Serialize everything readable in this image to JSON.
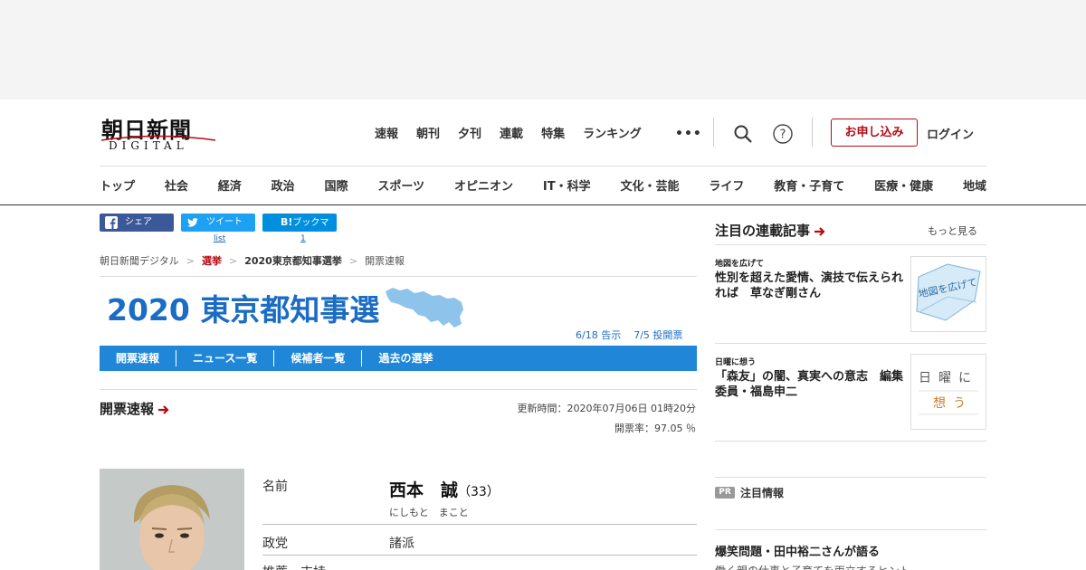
{
  "header": {
    "logo_main": "朝日新聞",
    "logo_sub": "DIGITAL",
    "top_nav": [
      "速報",
      "朝刊",
      "夕刊",
      "連載",
      "特集",
      "ランキング"
    ],
    "more_dots": "•••",
    "apply_label": "お申し込み",
    "login_label": "ログイン"
  },
  "categories": [
    "トップ",
    "社会",
    "経済",
    "政治",
    "国際",
    "スポーツ",
    "オピニオン",
    "IT・科学",
    "文化・芸能",
    "ライフ",
    "教育・子育て",
    "医療・健康",
    "地域"
  ],
  "share": {
    "facebook": "シェア",
    "twitter": "ツイート",
    "twitter_count": "list",
    "hatena": "ブックマーク",
    "hatena_prefix": "B!",
    "hatena_count": "1"
  },
  "breadcrumb": [
    "朝日新聞デジタル",
    "選挙",
    "2020東京都知事選挙",
    "開票速報"
  ],
  "banner": {
    "title": "2020 東京都知事選",
    "notice_date": "6/18 告示",
    "vote_date": "7/5 投開票"
  },
  "subnav": [
    "開票速報",
    "ニュース一覧",
    "候補者一覧",
    "過去の選挙"
  ],
  "results": {
    "section_title": "開票速報",
    "updated": "更新時間：2020年07月06日 01時20分",
    "count_rate": "開票率：97.05 ％"
  },
  "candidate": {
    "name_label": "名前",
    "name": "西本　誠",
    "age": "（33）",
    "kana": "にしもと　まこと",
    "party_label": "政党",
    "party": "諸派",
    "recommend_label": "推薦・支持"
  },
  "sidebar": {
    "title": "注目の連載記事",
    "more": "もっと見る",
    "articles": [
      {
        "tag": "地図を広げて",
        "headline": "性別を超えた愛情、演技で伝えられれば　草なぎ剛さん",
        "thumb_text": "地図を広げて"
      },
      {
        "tag": "日曜に想う",
        "headline": "「森友」の闇、真実への意志　編集委員・福島申二",
        "thumb_text": "日曜に想う"
      }
    ],
    "pr_badge": "PR",
    "pr_title": "注目情報",
    "bottom_headline": "爆笑問題・田中裕二さんが語る",
    "bottom_sub": "働く親の仕事と子育てを両立するヒント"
  },
  "colors": {
    "brand_red": "#b40b14",
    "election_blue": "#1a6cc4",
    "subnav_blue": "#2087d8"
  }
}
